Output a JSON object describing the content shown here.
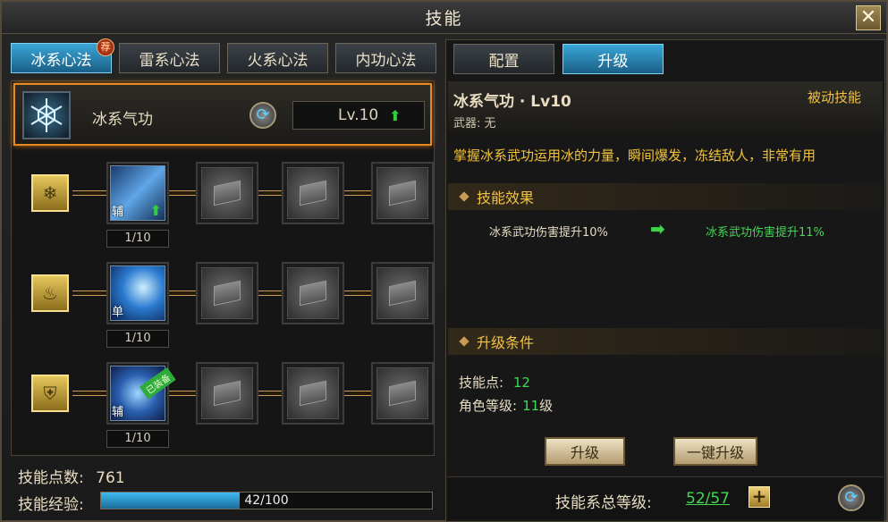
{
  "window": {
    "title": "技能",
    "close_label": "✕"
  },
  "left": {
    "tabs": [
      {
        "label": "冰系心法",
        "badge": "荐",
        "active": true
      },
      {
        "label": "雷系心法",
        "active": false
      },
      {
        "label": "火系心法",
        "active": false
      },
      {
        "label": "内功心法",
        "active": false
      }
    ],
    "main_skill": {
      "name": "冰系气功",
      "level": "Lv.10"
    },
    "rows": [
      {
        "category": "snowflake-icon",
        "skill_tag": "辅",
        "level": "1/10",
        "can_upgrade": true,
        "equipped": false
      },
      {
        "category": "flame-icon",
        "skill_tag": "单",
        "level": "1/10",
        "can_upgrade": false,
        "equipped": false
      },
      {
        "category": "shield-icon",
        "skill_tag": "辅",
        "level": "1/10",
        "can_upgrade": false,
        "equipped": true,
        "equipped_label": "已装备"
      }
    ],
    "skill_points_label": "技能点数:",
    "skill_points_value": "761",
    "exp_label": "技能经验:",
    "exp_text": "42/100",
    "exp_fraction": 0.42
  },
  "right": {
    "tabs": [
      {
        "label": "配置",
        "active": false
      },
      {
        "label": "升级",
        "active": true
      }
    ],
    "skill_name": "冰系气功 · Lv10",
    "skill_type": "被动技能",
    "weapon": "武器: 无",
    "description": "掌握冰系武功运用冰的力量，瞬间爆发，冻结敌人，非常有用",
    "effect_heading": "技能效果",
    "effect_current": "冰系武功伤害提升10%",
    "effect_next": "冰系武功伤害提升11%",
    "condition_heading": "升级条件",
    "cond_points_label": "技能点:",
    "cond_points_value": "12",
    "cond_level_label": "角色等级:",
    "cond_level_value": "11",
    "cond_level_unit": "级",
    "upgrade_button": "升级",
    "oneclick_button": "一键升级",
    "total_label": "技能系总等级:",
    "total_value": "52/57"
  },
  "colors": {
    "accent_blue": "#2e93c7",
    "gold": "#f0c246",
    "green": "#43d854",
    "orange_border": "#e48a22"
  }
}
